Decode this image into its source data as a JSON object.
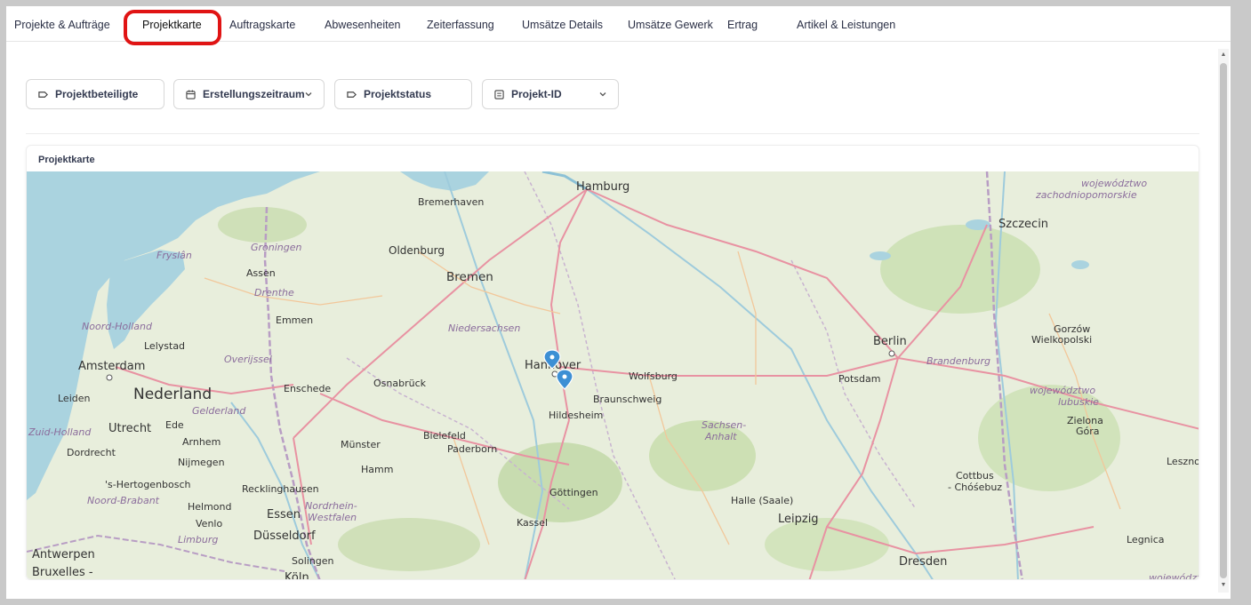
{
  "tabs": [
    {
      "label": "Projekte & Aufträge"
    },
    {
      "label": "Projektkarte"
    },
    {
      "label": "Auftragskarte"
    },
    {
      "label": "Abwesenheiten"
    },
    {
      "label": "Zeiterfassung"
    },
    {
      "label": "Umsätze Details"
    },
    {
      "label": "Umsätze Gewerk"
    },
    {
      "label": "Ertrag"
    },
    {
      "label": "Artikel & Leistungen"
    }
  ],
  "active_tab": "Projektkarte",
  "filters": {
    "participants": {
      "label": "Projektbeteiligte",
      "icon": "tag-icon"
    },
    "period": {
      "label": "Erstellungszeitraum",
      "icon": "calendar-icon"
    },
    "status": {
      "label": "Projektstatus",
      "icon": "tag-icon"
    },
    "project_id": {
      "label": "Projekt-ID",
      "icon": "list-icon"
    }
  },
  "card": {
    "title": "Projektkarte"
  },
  "map": {
    "cities": {
      "hamburg": "Hamburg",
      "bremerhaven": "Bremerhaven",
      "bremen": "Bremen",
      "oldenburg": "Oldenburg",
      "szczecin": "Szczecin",
      "berlin": "Berlin",
      "potsdam": "Potsdam",
      "hannover": "Hannover",
      "wolfsburg": "Wolfsburg",
      "braunschweig": "Braunschweig",
      "hildesheim": "Hildesheim",
      "osnabrueck": "Osnabrück",
      "bielefeld": "Bielefeld",
      "muenster": "Münster",
      "paderborn": "Paderborn",
      "hamm": "Hamm",
      "goettingen": "Göttingen",
      "kassel": "Kassel",
      "halle": "Halle (Saale)",
      "leipzig": "Leipzig",
      "dresden": "Dresden",
      "cottbus": "Cottbus",
      "chosebuz": "- Chóśebuz",
      "amsterdam": "Amsterdam",
      "lelystad": "Lelystad",
      "leiden": "Leiden",
      "utrecht": "Utrecht",
      "ede": "Ede",
      "arnhem": "Arnhem",
      "nijmegen": "Nijmegen",
      "dordrecht": "Dordrecht",
      "hertogenbosch": "'s-Hertogenbosch",
      "helmond": "Helmond",
      "venlo": "Venlo",
      "antwerpen": "Antwerpen",
      "bruxelles": "Bruxelles -",
      "assen": "Assen",
      "emmen": "Emmen",
      "enschede": "Enschede",
      "recklinghausen": "Recklinghausen",
      "essen": "Essen",
      "duesseldorf": "Düsseldorf",
      "solingen": "Solingen",
      "koeln": "Köln",
      "gorzow": "Gorzów",
      "wielkopolski": "Wielkopolski",
      "zielona": "Zielona",
      "gora": "Góra",
      "leszno": "Leszno",
      "legnica": "Legnica"
    },
    "regions": {
      "niedersachsen": "Niedersachsen",
      "brandenburg": "Brandenburg",
      "sachsen": "Sachsen-",
      "anhalt": "Anhalt",
      "nrw1": "Nordrhein-",
      "nrw2": "Westfalen",
      "groningen": "Groningen",
      "fryslan": "Fryslân",
      "drenthe": "Drenthe",
      "overijssel": "Overijssel",
      "gelderland": "Gelderland",
      "noordholland": "Noord-Holland",
      "zuidholland": "Zuid-Holland",
      "noordbrabant": "Noord-Brabant",
      "limburg": "Limburg",
      "zachodnio1": "województwo",
      "zachodnio2": "zachodniopomorskie",
      "lubuskie1": "województwo",
      "lubuskie2": "lubuskie",
      "dolno": "województwo"
    },
    "country": {
      "nederland": "Nederland"
    },
    "marker_color": "#3d8fd4"
  }
}
